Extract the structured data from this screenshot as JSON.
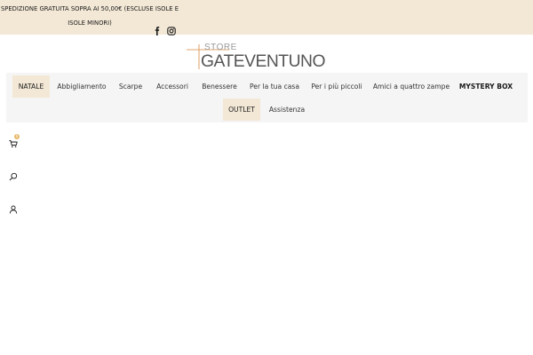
{
  "topbar": {
    "shipping_text": "SPEDIZIONE GRATUITA SOPRA AI 50,00€ (ESCLUSE ISOLE E ISOLE MINORI)",
    "social": [
      {
        "icon": "facebook-icon",
        "label": "f"
      },
      {
        "icon": "instagram-icon"
      }
    ]
  },
  "logo": {
    "small": "STORE",
    "main": "GATEVENTUNO"
  },
  "nav": {
    "items": [
      {
        "label": "NATALE"
      },
      {
        "label": "Abbigliamento"
      },
      {
        "label": "Scarpe"
      },
      {
        "label": "Accessori"
      },
      {
        "label": "Benessere"
      },
      {
        "label": "Per la tua casa"
      },
      {
        "label": "Per i più piccoli"
      },
      {
        "label": "Amici a quattro zampe"
      },
      {
        "label": "MYSTERY BOX"
      },
      {
        "label": "OUTLET"
      },
      {
        "label": "Assistenza"
      }
    ]
  },
  "side": {
    "cart_count": "0",
    "icons": [
      "cart-icon",
      "search-icon",
      "account-icon"
    ]
  },
  "colors": {
    "accent_beige": "#f3e8d6",
    "nav_background": "#f5f5f5",
    "badge": "#e7b96a",
    "logo_orange": "#d98a3d",
    "logo_gray": "#555555"
  }
}
